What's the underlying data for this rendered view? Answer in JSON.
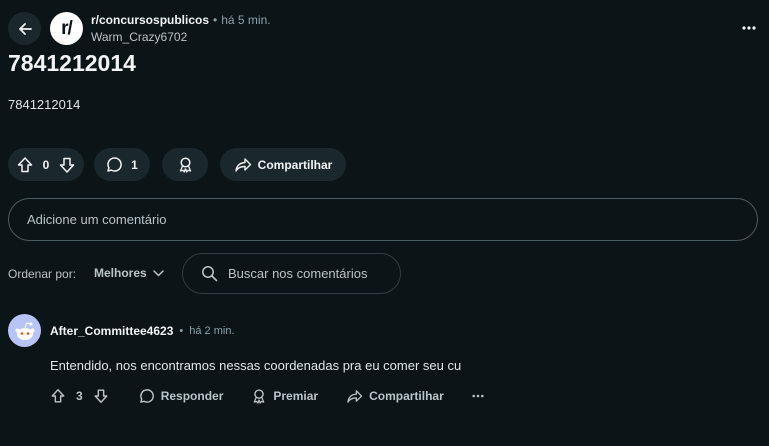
{
  "post": {
    "subreddit": "r/concursospublicos",
    "subreddit_avatar_text": "r/",
    "separator": "•",
    "time": "há 5 min.",
    "author": "Warm_Crazy6702",
    "title": "7841212014",
    "body": "7841212014",
    "score": "0",
    "comments_count": "1",
    "share_label": "Compartilhar"
  },
  "comment_box": {
    "placeholder": "Adicione um comentário"
  },
  "sort": {
    "label": "Ordenar por:",
    "value": "Melhores"
  },
  "search": {
    "placeholder": "Buscar nos comentários"
  },
  "comments": [
    {
      "author": "After_Committee4623",
      "separator": "•",
      "time": "há 2 min.",
      "body": "Entendido, nos encontramos nessas coordenadas pra eu comer seu cu",
      "score": "3",
      "reply_label": "Responder",
      "award_label": "Premiar",
      "share_label": "Compartilhar"
    }
  ],
  "colors": {
    "background": "#0b1416",
    "pill": "#1a282d",
    "avatar_comment": "#b9c4f6"
  },
  "icons": [
    "back-arrow-icon",
    "more-icon",
    "upvote-icon",
    "downvote-icon",
    "comment-icon",
    "award-icon",
    "share-icon",
    "chevron-down-icon",
    "search-icon",
    "snoo-avatar-icon"
  ]
}
